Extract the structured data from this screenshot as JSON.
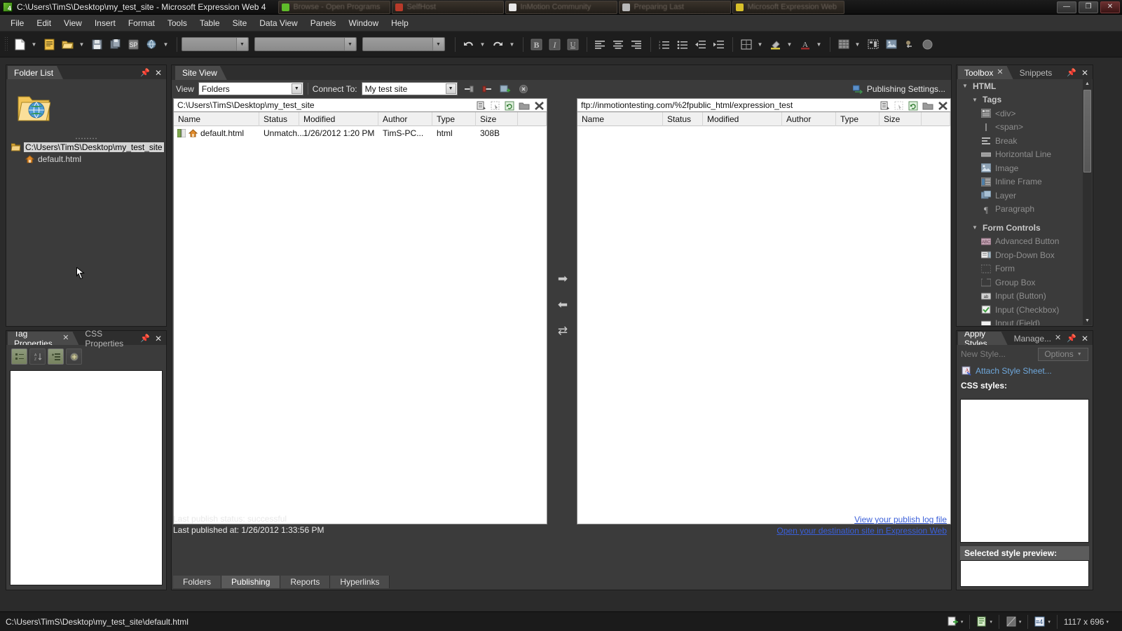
{
  "window": {
    "title": "C:\\Users\\TimS\\Desktop\\my_test_site - Microsoft Expression Web 4",
    "app_icon": "expression-web-icon",
    "minimize": "—",
    "maximize": "❐",
    "close": "✕"
  },
  "taskbar": {
    "items": [
      {
        "label": "Browse - Open Programs",
        "color": "#5fbb2a"
      },
      {
        "label": "SelfHost",
        "color": "#b83a2a"
      },
      {
        "label": "InMotion Community",
        "color": "#e8e8e8"
      },
      {
        "label": "Preparing Last",
        "color": "#b8b8b8"
      },
      {
        "label": "Microsoft Expression Web",
        "color": "#d8c02a"
      }
    ]
  },
  "menubar": {
    "items": [
      "File",
      "Edit",
      "View",
      "Insert",
      "Format",
      "Tools",
      "Table",
      "Site",
      "Data View",
      "Panels",
      "Window",
      "Help"
    ]
  },
  "toolbar": {
    "buttons": [
      {
        "name": "new-document-icon",
        "has_arrow": true
      },
      {
        "name": "new-page-icon",
        "has_arrow": false
      },
      {
        "name": "open-folder-icon",
        "has_arrow": true
      },
      {
        "name": "save-icon",
        "has_arrow": false
      },
      {
        "name": "save-all-icon",
        "has_arrow": false
      },
      {
        "name": "sharepoint-icon",
        "has_arrow": false
      },
      {
        "name": "preview-browser-icon",
        "has_arrow": true
      }
    ],
    "combos": [
      "",
      "",
      ""
    ],
    "undo": "undo-icon",
    "redo": "redo-icon",
    "format_buttons": [
      "bold-icon",
      "italic-icon",
      "underline-icon",
      "align-left-icon",
      "align-center-icon",
      "align-right-icon",
      "numbered-list-icon",
      "bullet-list-icon",
      "decrease-indent-icon",
      "increase-indent-icon",
      "borders-icon",
      "highlight-icon",
      "font-color-icon",
      "table-icon",
      "layout-tables-icon",
      "picture-icon",
      "hyperlink-icon",
      "help-icon"
    ]
  },
  "folder_list": {
    "tab_label": "Folder List",
    "tab_close": "✕",
    "pin": "pin-icon",
    "close": "✕",
    "preview_icon": "website-folder-icon",
    "tree": [
      {
        "label": "C:\\Users\\TimS\\Desktop\\my_test_site",
        "icon": "folder-icon",
        "selected": true
      },
      {
        "label": "default.html",
        "icon": "home-page-icon",
        "selected": false
      }
    ]
  },
  "tag_properties": {
    "tabs": [
      {
        "label": "Tag Properties",
        "active": true,
        "closable": true
      },
      {
        "label": "CSS Properties",
        "active": false,
        "closable": false
      }
    ],
    "pin": "pin-icon",
    "close": "✕",
    "toolbuttons": [
      "categorized-view-icon",
      "alphabetical-view-icon",
      "set-value-icon",
      "add-attribute-icon"
    ]
  },
  "site_view": {
    "tab_label": "Site View",
    "view_label": "View",
    "view_value": "Folders",
    "connect_label": "Connect To:",
    "connect_value": "My test site",
    "connect_buttons": [
      "connect-icon",
      "disconnect-icon",
      "add-connection-icon",
      "delete-connection-icon"
    ],
    "publishing_settings": "Publishing Settings...",
    "publishing_settings_icon": "publish-settings-icon",
    "local": {
      "path": "C:\\Users\\TimS\\Desktop\\my_test_site",
      "tools": [
        "list-view-icon",
        "select-icon",
        "refresh-icon",
        "new-folder-icon",
        "delete-icon"
      ],
      "columns": [
        "Name",
        "Status",
        "Modified",
        "Author",
        "Type",
        "Size",
        ""
      ],
      "rows": [
        {
          "name": "default.html",
          "status": "Unmatch...",
          "modified": "1/26/2012 1:20 PM",
          "author": "TimS-PC...",
          "type": "html",
          "size": "308B"
        }
      ]
    },
    "remote": {
      "path": "ftp://inmotiontesting.com/%2fpublic_html/expression_test",
      "tools": [
        "list-view-icon",
        "select-icon",
        "refresh-icon",
        "new-folder-icon",
        "delete-icon"
      ],
      "columns": [
        "Name",
        "Status",
        "Modified",
        "Author",
        "Type",
        "Size",
        ""
      ],
      "rows": []
    },
    "transfer_arrows": [
      "publish-right-arrow",
      "publish-left-arrow",
      "synchronize-arrow"
    ],
    "status_lines": [
      "Last publish status: successful",
      "Last published at: 1/26/2012 1:33:56 PM"
    ],
    "links": [
      "View your publish log file",
      "Open your destination site in Expression Web"
    ],
    "bottom_tabs": [
      {
        "label": "Folders",
        "active": false
      },
      {
        "label": "Publishing",
        "active": true
      },
      {
        "label": "Reports",
        "active": false
      },
      {
        "label": "Hyperlinks",
        "active": false
      }
    ]
  },
  "toolbox": {
    "tabs": [
      {
        "label": "Toolbox",
        "active": true,
        "closable": true
      },
      {
        "label": "Snippets",
        "active": false,
        "closable": false
      }
    ],
    "pin": "pin-icon",
    "close": "✕",
    "sections": [
      {
        "label": "HTML",
        "level": 0,
        "group": true,
        "icon": ""
      },
      {
        "label": "Tags",
        "level": 1,
        "group": true,
        "icon": ""
      },
      {
        "label": "<div>",
        "level": 2,
        "group": false,
        "icon": "div-tag-icon"
      },
      {
        "label": "<span>",
        "level": 2,
        "group": false,
        "icon": "span-tag-icon"
      },
      {
        "label": "Break",
        "level": 2,
        "group": false,
        "icon": "break-icon"
      },
      {
        "label": "Horizontal Line",
        "level": 2,
        "group": false,
        "icon": "horizontal-line-icon"
      },
      {
        "label": "Image",
        "level": 2,
        "group": false,
        "icon": "image-icon"
      },
      {
        "label": "Inline Frame",
        "level": 2,
        "group": false,
        "icon": "inline-frame-icon"
      },
      {
        "label": "Layer",
        "level": 2,
        "group": false,
        "icon": "layer-icon"
      },
      {
        "label": "Paragraph",
        "level": 2,
        "group": false,
        "icon": "paragraph-icon"
      },
      {
        "label": "Form Controls",
        "level": 1,
        "group": true,
        "icon": ""
      },
      {
        "label": "Advanced Button",
        "level": 2,
        "group": false,
        "icon": "advanced-button-icon"
      },
      {
        "label": "Drop-Down Box",
        "level": 2,
        "group": false,
        "icon": "dropdown-box-icon"
      },
      {
        "label": "Form",
        "level": 2,
        "group": false,
        "icon": "form-icon"
      },
      {
        "label": "Group Box",
        "level": 2,
        "group": false,
        "icon": "group-box-icon"
      },
      {
        "label": "Input (Button)",
        "level": 2,
        "group": false,
        "icon": "input-button-icon"
      },
      {
        "label": "Input (Checkbox)",
        "level": 2,
        "group": false,
        "icon": "input-checkbox-icon"
      },
      {
        "label": "Input (Field)",
        "level": 2,
        "group": false,
        "icon": "input-field-icon"
      }
    ]
  },
  "apply_styles": {
    "tabs": [
      {
        "label": "Apply Styles",
        "active": true,
        "closable": false
      },
      {
        "label": "Manage...",
        "active": false,
        "closable": true
      }
    ],
    "pin": "pin-icon",
    "close": "✕",
    "new_style": "New Style...",
    "options": "Options",
    "options_caret": "▼",
    "attach_style_sheet": "Attach Style Sheet...",
    "attach_icon": "attach-stylesheet-icon",
    "css_styles_label": "CSS styles:",
    "selected_style_preview_label": "Selected style preview:"
  },
  "statusbar": {
    "path": "C:\\Users\\TimS\\Desktop\\my_test_site\\default.html",
    "cells": [
      {
        "icon": "visual-aids-icon",
        "label": "",
        "caret": "▾"
      },
      {
        "icon": "compatibility-icon",
        "label": "",
        "caret": "▾"
      },
      {
        "icon": "css-schema-icon",
        "label": "",
        "caret": "▾"
      },
      {
        "icon": "page-size-icon",
        "label": "",
        "caret": "▾"
      },
      {
        "icon": "",
        "label": "1117 x 696",
        "caret": "▾"
      }
    ]
  },
  "colors": {
    "accent_blue": "#3a5fd9",
    "link_blue": "#6fa8dc",
    "panel_bg": "#3b3b3b",
    "chrome_bg": "#2b2b2b",
    "toolbar_bg": "#1d1d1d"
  }
}
